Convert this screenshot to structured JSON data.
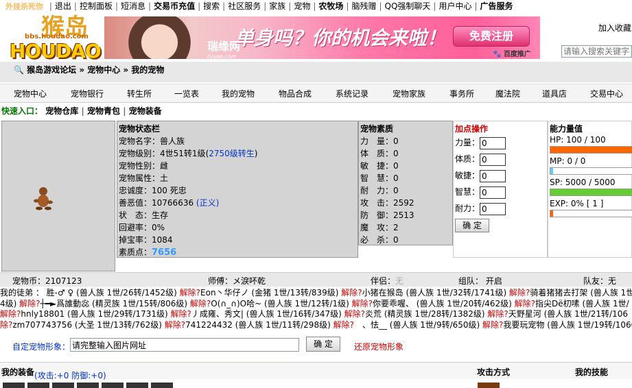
{
  "topnav": {
    "items": [
      "外挂杀死你",
      "退出",
      "控制面板",
      "短消息",
      "交易币充值",
      "搜索",
      "社区服务",
      "家族",
      "宠物",
      "农牧场",
      "脑残赠",
      "QQ强制聊天",
      "用户中心",
      "广告服务"
    ]
  },
  "logo": {
    "main": "HOUDAO",
    "cn": "猴岛",
    "url": "bbs.houdao.com"
  },
  "banner": {
    "watermark": "瑞缘网",
    "watermark_url": "ryuan.com",
    "slogan": "单身吗？你的机会来啦！",
    "register": "免费注册",
    "baidu": "百度推广"
  },
  "header": {
    "favorite": "加入收藏",
    "search_placeholder": "请输入搜索关键字"
  },
  "breadcrumb": {
    "text": "猴岛游戏论坛 » 宠物中心 » 我的宠物"
  },
  "menu": [
    "宠物中心",
    "宠物银行",
    "转生所",
    "一览表",
    "我的宠物",
    "物品合成",
    "系统记录",
    "宠物家族",
    "事务所",
    "魔法院",
    "道具店",
    "交易中心"
  ],
  "quick": {
    "label": "快速入口：",
    "links": [
      "宠物仓库",
      "宠物青包",
      "宠物装备"
    ]
  },
  "status": {
    "title": "宠物状态栏",
    "name_label": "宠物名字：",
    "name": "兽人族",
    "level_label": "宠物级别：",
    "level": "4世51转1级",
    "level_link": "2750级转生",
    "gender_label": "宠物性别：",
    "gender": "雌",
    "attr_label": "宠物属性：",
    "attr": "土",
    "loyalty_label": "忠诚度：",
    "loyalty": "100 死忠",
    "karma_label": "善恶值：",
    "karma": "10766636",
    "karma_tag": "(正义)",
    "state_label": "状　态：",
    "state": "生存",
    "dodge_label": "回避率：",
    "dodge": "0%",
    "drop_label": "掉宝率：",
    "drop": "1084",
    "points_label": "素质点：",
    "points": "7656"
  },
  "quality": {
    "title": "宠物素质",
    "rows": [
      {
        "label": "力　量：",
        "value": "0"
      },
      {
        "label": "体　质：",
        "value": "0"
      },
      {
        "label": "敏　捷：",
        "value": "0"
      },
      {
        "label": "智　慧：",
        "value": "0"
      },
      {
        "label": "耐　力：",
        "value": "0"
      },
      {
        "label": "攻　击：",
        "value": "2592"
      },
      {
        "label": "防　御：",
        "value": "2513"
      },
      {
        "label": "魔　攻：",
        "value": "2"
      },
      {
        "label": "必　杀：",
        "value": "0"
      }
    ]
  },
  "addpt": {
    "title": "加点操作",
    "rows": [
      {
        "label": "力量：",
        "value": "0"
      },
      {
        "label": "体质：",
        "value": "0"
      },
      {
        "label": "敏捷：",
        "value": "0"
      },
      {
        "label": "智慧：",
        "value": "0"
      },
      {
        "label": "耐力：",
        "value": "0"
      }
    ],
    "confirm": "确 定"
  },
  "ability": {
    "title": "能力量值",
    "hp_text": "HP: 100 / 100",
    "hp_fraction": 1.0,
    "mp_text": "MP: 0 / 0",
    "mp_fraction": 0.0,
    "sp_text": "SP: 5000 / 5000",
    "sp_fraction": 1.0,
    "exp_text": "EXP: 0% [ 1 ]",
    "exp_fraction": 0.0,
    "colors": {
      "hp": "#ff6600",
      "mp": "#66ccff",
      "sp": "#66cc33",
      "exp": "#ff6600"
    }
  },
  "info": {
    "coins": "宠物币：2107123",
    "master": "师傅：メ淚吥乾",
    "partner_label": "伴侣：",
    "partner": "无",
    "group": "组队：  开启",
    "team": "队友：无"
  },
  "apprentice": {
    "lines": [
      [
        {
          "t": "我的徒弟 ： 胜-♂ ♀ (兽人族 1世/26转/1452级) "
        },
        {
          "t": "解除?",
          "r": 1
        },
        {
          "t": "Eon丶华仔ノ (金猪 1世/13转/839级) "
        },
        {
          "t": "解除?",
          "r": 1
        },
        {
          "t": "小猪在猴岛 (兽人族 1世/32转/1741级) "
        },
        {
          "t": "解除?",
          "r": 1
        },
        {
          "t": "骑着猪猪去打架 (兽人族 1世/15转/8"
        }
      ],
      [
        {
          "t": "4级) "
        },
        {
          "t": "解除?",
          "r": 1
        },
        {
          "t": "┼━►爲誰動惢 (精灵族 1世/15转/806级) "
        },
        {
          "t": "解除?",
          "r": 1
        },
        {
          "t": "O(∩_∩)O哈~ (兽人族 1世/12转/1级) "
        },
        {
          "t": "解除?",
          "r": 1
        },
        {
          "t": "你要乖喔、 (兽人族 1世/20转/462级) "
        },
        {
          "t": "解除?",
          "r": 1
        },
        {
          "t": "指尖Dё朷嗉 (兽人族 1世/"
        }
      ],
      [
        {
          "t": "解除?",
          "r": 1
        },
        {
          "t": "hnly18801 (兽人族 1世/29转/1731级) "
        },
        {
          "t": "解除?",
          "r": 1
        },
        {
          "t": "丿成雍、秀文| (兽人族 1世/16转/347级) "
        },
        {
          "t": "解除?",
          "r": 1
        },
        {
          "t": "炎荒 (精灵族 1世/28转/1382级) "
        },
        {
          "t": "解除?",
          "r": 1
        },
        {
          "t": "天野星河 (兽人族 1世/21转/106"
        }
      ],
      [
        {
          "t": "除?",
          "r": 1
        },
        {
          "t": "zm707743756 (大圣 1世/13转/762级) "
        },
        {
          "t": "解除?",
          "r": 1
        },
        {
          "t": "741224432 (兽人族 1世/11转/298级) "
        },
        {
          "t": "解除?",
          "r": 1
        },
        {
          "t": "　、怯__ (兽人族 1世/9转/650级) "
        },
        {
          "t": "解除?",
          "r": 1
        },
        {
          "t": "我要玩宠物 (兽人族 1世/19转/1060级"
        }
      ]
    ]
  },
  "custom": {
    "label": "自定宠物形象：",
    "placeholder": "请完整输入图片网址",
    "value": "请完整输入图片网址",
    "ok": "确 定",
    "restore": "还原宠物形象"
  },
  "equip": {
    "title": "我的装备",
    "stats": "(攻击:+0 防御:+0)",
    "attack_mode": "攻击方式",
    "skills": "我的技能"
  }
}
